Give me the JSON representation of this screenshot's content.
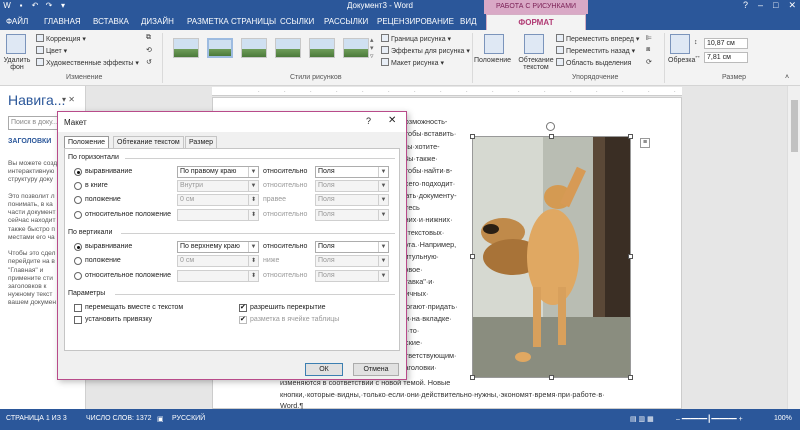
{
  "window": {
    "title": "Документ3 - Word"
  },
  "contextual_tab": "РАБОТА С РИСУНКАМИ",
  "tabs": [
    "ФАЙЛ",
    "ГЛАВНАЯ",
    "ВСТАВКА",
    "ДИЗАЙН",
    "РАЗМЕТКА СТРАНИЦЫ",
    "ССЫЛКИ",
    "РАССЫЛКИ",
    "РЕЦЕНЗИРОВАНИЕ",
    "ВИД",
    "ФОРМАТ"
  ],
  "ribbon": {
    "remove_bg": "Удалить фон",
    "correction": "Коррекция",
    "color": "Цвет",
    "artistic": "Художественные эффекты",
    "group_change": "Изменение",
    "group_styles": "Стили рисунков",
    "border": "Граница рисунка",
    "effects": "Эффекты для рисунка",
    "layout": "Макет рисунка",
    "position": "Положение",
    "wrap": "Обтекание текстом",
    "forward": "Переместить вперед",
    "backward": "Переместить назад",
    "selection": "Область выделения",
    "group_arrange": "Упорядочение",
    "crop": "Обрезка",
    "height": "10,87 см",
    "width": "7,81 см",
    "group_size": "Размер"
  },
  "nav": {
    "title": "Навига...",
    "search_placeholder": "Поиск в доку...",
    "tab": "ЗАГОЛОВКИ",
    "text": [
      "Вы можете созд",
      "интерактивную",
      "структуру доку",
      "",
      "Это позволит л",
      "понимать, в ка",
      "части документ",
      "сейчас находит",
      "также быстро п",
      "местами его ча",
      "",
      "Чтобы это сдел",
      "перейдите на в",
      "\"Главная\" и",
      "примените сти",
      "заголовков к",
      "нужному текст",
      "вашем докумен"
    ]
  },
  "doc": {
    "lines": [
      "возможность-",
      "чтобы·вставить·",
      "·вы·хотите-",
      "·Вы·также·",
      "чтобы·найти·в-",
      "всего·подходит·",
      "дать·документу-",
      "йтесь",
      "хних·и·нижних·",
      "и·текстовых·",
      "руга.·Например,",
      "титульную·",
      "ковое·",
      "ставка\"·и·",
      "личных·",
      "могают·придать·",
      "ли·на·вкладке·",
      "о,·то·",
      "еские·",
      "ответствующим·",
      "заголовки·"
    ],
    "foot1": "изменяются в соответствии с новой темой. Новые",
    "foot2": "кнопки,·которые·видны,·только·если·они·действительно·нужны,·экономят·время·при·работе·в·",
    "foot3": "Word.¶"
  },
  "dialog": {
    "title": "Макет",
    "help": "?",
    "close": "✕",
    "tabs": [
      "Положение",
      "Обтекание текстом",
      "Размер"
    ],
    "horizontal": {
      "header": "По горизонтали",
      "align_label": "выравнивание",
      "align_value": "По правому краю",
      "rel_label": "относительно",
      "rel_value": "Поля",
      "book_label": "в книге",
      "book_value": "Внутри",
      "book_rel": "Поля",
      "pos_label": "положение",
      "pos_value": "0 см",
      "pos_rel_label": "правее",
      "pos_rel": "Поля",
      "relpos_label": "относительное положение",
      "relpos_rel_label": "относительно",
      "relpos_rel": "Поля"
    },
    "vertical": {
      "header": "По вертикали",
      "align_label": "выравнивание",
      "align_value": "По верхнему краю",
      "rel_label": "относительно",
      "rel_value": "Поля",
      "pos_label": "положение",
      "pos_value": "0 см",
      "pos_rel_label": "ниже",
      "pos_rel": "Поля",
      "relpos_label": "относительное положение",
      "relpos_rel_label": "относительно",
      "relpos_rel": "Поля"
    },
    "options": {
      "header": "Параметры",
      "move_with_text": "перемещать вместе с текстом",
      "lock_anchor": "установить привязку",
      "allow_overlap": "разрешить перекрытие",
      "layout_in_cell": "разметка в ячейке таблицы"
    },
    "ok": "ОК",
    "cancel": "Отмена"
  },
  "status": {
    "page": "СТРАНИЦА 1 ИЗ 3",
    "words": "ЧИСЛО СЛОВ: 1372",
    "lang": "РУССКИЙ",
    "zoom": "100%"
  },
  "colors": {
    "accent": "#2b579a",
    "picture_tools": "#b84b8a"
  }
}
